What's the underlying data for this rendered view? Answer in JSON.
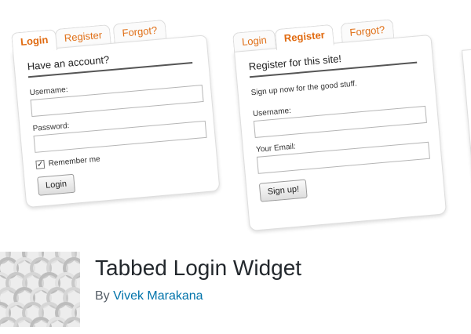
{
  "login_widget": {
    "tabs": [
      "Login",
      "Register",
      "Forgot?"
    ],
    "title": "Have an account?",
    "username_label": "Username:",
    "password_label": "Password:",
    "remember_label": "Remember me",
    "remember_checked": true,
    "button_label": "Login"
  },
  "register_widget": {
    "tabs": [
      "Login",
      "Register",
      "Forgot?"
    ],
    "title": "Register for this site!",
    "description": "Sign up now for the good stuff.",
    "username_label": "Username:",
    "email_label": "Your Email:",
    "button_label": "Sign up!"
  },
  "plugin": {
    "name": "Tabbed Login Widget",
    "by_label": "By",
    "author": "Vivek Marakana"
  },
  "colors": {
    "tab_accent": "#e07018",
    "author_link": "#0073aa"
  }
}
